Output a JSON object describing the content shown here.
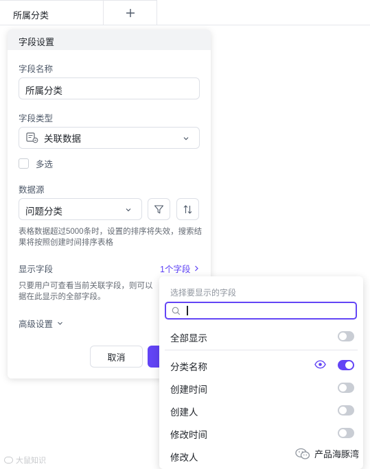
{
  "table": {
    "column_header": "所属分类",
    "add_column_icon": "plus-icon"
  },
  "panel": {
    "title": "字段设置",
    "field_name_label": "字段名称",
    "field_name_value": "所属分类",
    "field_type_label": "字段类型",
    "field_type_value": "关联数据",
    "field_type_icon": "linked-data-icon",
    "multi_select_label": "多选",
    "multi_select_checked": false,
    "data_source_label": "数据源",
    "data_source_value": "问题分类",
    "filter_icon": "filter-icon",
    "sort_icon": "sort-icon",
    "sort_hint": "表格数据超过5000条时，设置的排序将失效，搜索结果将按照创建时间排序表格",
    "display_fields_label": "显示字段",
    "display_fields_link": "1个字段",
    "display_fields_hint": "只要用户可查看当前关联字段，则可以\n据在此显示的全部字段。",
    "advanced_label": "高级设置",
    "cancel_label": "取消"
  },
  "dropdown": {
    "title": "选择要显示的字段",
    "search_placeholder": "",
    "show_all_label": "全部显示",
    "show_all_on": false,
    "fields": [
      {
        "name": "分类名称",
        "on": true,
        "visible_icon": "eye-icon"
      },
      {
        "name": "创建时间",
        "on": false
      },
      {
        "name": "创建人",
        "on": false
      },
      {
        "name": "修改时间",
        "on": false
      },
      {
        "name": "修改人",
        "on": false
      }
    ]
  },
  "colors": {
    "accent": "#6244f5",
    "toggle_off": "#c9cdd4",
    "border": "#dcdfe6"
  },
  "watermark": {
    "left_text": "大鼠知识",
    "right_text": "产品海豚湾"
  }
}
